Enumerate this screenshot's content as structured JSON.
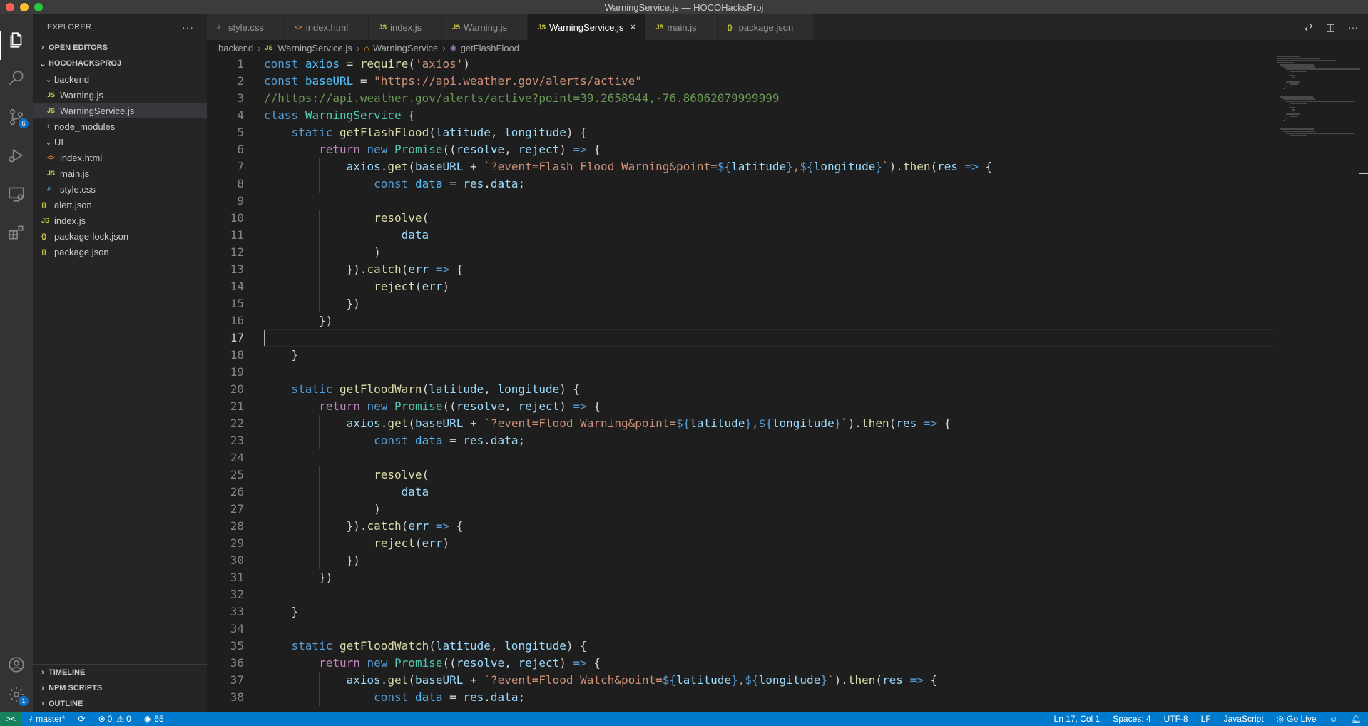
{
  "window": {
    "title": "WarningService.js — HOCOHacksProj"
  },
  "colors": {
    "accent": "#007acc",
    "remote": "#16825d",
    "badge": "#0e70c0"
  },
  "activity_bar": {
    "items": [
      {
        "name": "explorer",
        "icon": "files-icon"
      },
      {
        "name": "search",
        "icon": "search-icon"
      },
      {
        "name": "source-control",
        "icon": "source-control-icon",
        "badge": "6"
      },
      {
        "name": "run-debug",
        "icon": "run-debug-icon"
      },
      {
        "name": "remote-explorer",
        "icon": "remote-explorer-icon"
      },
      {
        "name": "extensions",
        "icon": "extensions-icon"
      }
    ],
    "bottom": [
      {
        "name": "accounts",
        "icon": "account-icon"
      },
      {
        "name": "manage",
        "icon": "gear-icon",
        "badge": "1"
      }
    ]
  },
  "sidebar": {
    "title": "EXPLORER",
    "more": "···",
    "open_editors": "OPEN EDITORS",
    "project": "HOCOHACKSPROJ",
    "tree": [
      {
        "label": "backend",
        "type": "folder",
        "open": true,
        "indent": 1
      },
      {
        "label": "Warning.js",
        "type": "js",
        "indent": 2,
        "icon_text": "JS"
      },
      {
        "label": "WarningService.js",
        "type": "js",
        "indent": 2,
        "icon_text": "JS",
        "selected": true
      },
      {
        "label": "node_modules",
        "type": "folder",
        "open": false,
        "indent": 1
      },
      {
        "label": "UI",
        "type": "folder",
        "open": true,
        "indent": 1
      },
      {
        "label": "index.html",
        "type": "html",
        "indent": 2,
        "icon_text": "<>"
      },
      {
        "label": "main.js",
        "type": "js",
        "indent": 2,
        "icon_text": "JS"
      },
      {
        "label": "style.css",
        "type": "css",
        "indent": 2,
        "icon_text": "#"
      },
      {
        "label": "alert.json",
        "type": "json",
        "indent": 1,
        "icon_text": "{}"
      },
      {
        "label": "index.js",
        "type": "js",
        "indent": 1,
        "icon_text": "JS"
      },
      {
        "label": "package-lock.json",
        "type": "json",
        "indent": 1,
        "icon_text": "{}"
      },
      {
        "label": "package.json",
        "type": "json",
        "indent": 1,
        "icon_text": "{}"
      }
    ],
    "bottom_sections": [
      "TIMELINE",
      "NPM SCRIPTS",
      "OUTLINE"
    ]
  },
  "tabs": [
    {
      "label": "style.css",
      "type": "css",
      "icon_text": "#"
    },
    {
      "label": "index.html",
      "type": "html",
      "icon_text": "<>"
    },
    {
      "label": "index.js",
      "type": "js",
      "icon_text": "JS"
    },
    {
      "label": "Warning.js",
      "type": "js",
      "icon_text": "JS"
    },
    {
      "label": "WarningService.js",
      "type": "js",
      "icon_text": "JS",
      "active": true,
      "close": "✕"
    },
    {
      "label": "main.js",
      "type": "js",
      "icon_text": "JS"
    },
    {
      "label": "package.json",
      "type": "json",
      "icon_text": "{}"
    }
  ],
  "breadcrumb": {
    "folder": "backend",
    "file": "WarningService.js",
    "file_icon": "JS",
    "class": "WarningService",
    "method": "getFlashFlood"
  },
  "editor": {
    "current_line": 17,
    "lines": [
      [
        [
          "k",
          "const"
        ],
        [
          "p",
          " "
        ],
        [
          "cv",
          "axios"
        ],
        [
          "p",
          " = "
        ],
        [
          "f",
          "require"
        ],
        [
          "p",
          "("
        ],
        [
          "s",
          "'axios'"
        ],
        [
          "p",
          ")"
        ]
      ],
      [
        [
          "k",
          "const"
        ],
        [
          "p",
          " "
        ],
        [
          "cv",
          "baseURL"
        ],
        [
          "p",
          " = "
        ],
        [
          "s",
          "\""
        ],
        [
          "u",
          "https://api.weather.gov/alerts/active"
        ],
        [
          "s",
          "\""
        ]
      ],
      [
        [
          "cm",
          "//"
        ],
        [
          "cmu",
          "https://api.weather.gov/alerts/active?point=39.2658944,-76.86062079999999"
        ]
      ],
      [
        [
          "k",
          "class"
        ],
        [
          "p",
          " "
        ],
        [
          "t",
          "WarningService"
        ],
        [
          "p",
          " {"
        ]
      ],
      [
        [
          "p",
          "    "
        ],
        [
          "k",
          "static"
        ],
        [
          "p",
          " "
        ],
        [
          "f",
          "getFlashFlood"
        ],
        [
          "p",
          "("
        ],
        [
          "v",
          "latitude"
        ],
        [
          "p",
          ", "
        ],
        [
          "v",
          "longitude"
        ],
        [
          "p",
          ") {"
        ]
      ],
      [
        [
          "p",
          "        "
        ],
        [
          "c",
          "return"
        ],
        [
          "p",
          " "
        ],
        [
          "k",
          "new"
        ],
        [
          "p",
          " "
        ],
        [
          "t",
          "Promise"
        ],
        [
          "p",
          "(("
        ],
        [
          "v",
          "resolve"
        ],
        [
          "p",
          ", "
        ],
        [
          "v",
          "reject"
        ],
        [
          "p",
          ") "
        ],
        [
          "k",
          "=>"
        ],
        [
          "p",
          " {"
        ]
      ],
      [
        [
          "p",
          "            "
        ],
        [
          "v",
          "axios"
        ],
        [
          "p",
          "."
        ],
        [
          "f",
          "get"
        ],
        [
          "p",
          "("
        ],
        [
          "v",
          "baseURL"
        ],
        [
          "p",
          " + "
        ],
        [
          "s",
          "`?event=Flash Flood Warning&point="
        ],
        [
          "k",
          "${"
        ],
        [
          "v",
          "latitude"
        ],
        [
          "k",
          "}"
        ],
        [
          "s",
          ","
        ],
        [
          "k",
          "${"
        ],
        [
          "v",
          "longitude"
        ],
        [
          "k",
          "}"
        ],
        [
          "s",
          "`"
        ],
        [
          "p",
          ")."
        ],
        [
          "f",
          "then"
        ],
        [
          "p",
          "("
        ],
        [
          "v",
          "res"
        ],
        [
          "p",
          " "
        ],
        [
          "k",
          "=>"
        ],
        [
          "p",
          " {"
        ]
      ],
      [
        [
          "p",
          "                "
        ],
        [
          "k",
          "const"
        ],
        [
          "p",
          " "
        ],
        [
          "cv",
          "data"
        ],
        [
          "p",
          " = "
        ],
        [
          "v",
          "res"
        ],
        [
          "p",
          "."
        ],
        [
          "v",
          "data"
        ],
        [
          "p",
          ";"
        ]
      ],
      [
        [
          "p",
          ""
        ]
      ],
      [
        [
          "p",
          "                "
        ],
        [
          "f",
          "resolve"
        ],
        [
          "p",
          "("
        ]
      ],
      [
        [
          "p",
          "                    "
        ],
        [
          "v",
          "data"
        ]
      ],
      [
        [
          "p",
          "                )"
        ]
      ],
      [
        [
          "p",
          "            })."
        ],
        [
          "f",
          "catch"
        ],
        [
          "p",
          "("
        ],
        [
          "v",
          "err"
        ],
        [
          "p",
          " "
        ],
        [
          "k",
          "=>"
        ],
        [
          "p",
          " {"
        ]
      ],
      [
        [
          "p",
          "                "
        ],
        [
          "f",
          "reject"
        ],
        [
          "p",
          "("
        ],
        [
          "v",
          "err"
        ],
        [
          "p",
          ")"
        ]
      ],
      [
        [
          "p",
          "            })"
        ]
      ],
      [
        [
          "p",
          "        })"
        ]
      ],
      [
        [
          "p",
          ""
        ]
      ],
      [
        [
          "p",
          "    }"
        ]
      ],
      [
        [
          "p",
          ""
        ]
      ],
      [
        [
          "p",
          "    "
        ],
        [
          "k",
          "static"
        ],
        [
          "p",
          " "
        ],
        [
          "f",
          "getFloodWarn"
        ],
        [
          "p",
          "("
        ],
        [
          "v",
          "latitude"
        ],
        [
          "p",
          ", "
        ],
        [
          "v",
          "longitude"
        ],
        [
          "p",
          ") {"
        ]
      ],
      [
        [
          "p",
          "        "
        ],
        [
          "c",
          "return"
        ],
        [
          "p",
          " "
        ],
        [
          "k",
          "new"
        ],
        [
          "p",
          " "
        ],
        [
          "t",
          "Promise"
        ],
        [
          "p",
          "(("
        ],
        [
          "v",
          "resolve"
        ],
        [
          "p",
          ", "
        ],
        [
          "v",
          "reject"
        ],
        [
          "p",
          ") "
        ],
        [
          "k",
          "=>"
        ],
        [
          "p",
          " {"
        ]
      ],
      [
        [
          "p",
          "            "
        ],
        [
          "v",
          "axios"
        ],
        [
          "p",
          "."
        ],
        [
          "f",
          "get"
        ],
        [
          "p",
          "("
        ],
        [
          "v",
          "baseURL"
        ],
        [
          "p",
          " + "
        ],
        [
          "s",
          "`?event=Flood Warning&point="
        ],
        [
          "k",
          "${"
        ],
        [
          "v",
          "latitude"
        ],
        [
          "k",
          "}"
        ],
        [
          "s",
          ","
        ],
        [
          "k",
          "${"
        ],
        [
          "v",
          "longitude"
        ],
        [
          "k",
          "}"
        ],
        [
          "s",
          "`"
        ],
        [
          "p",
          ")."
        ],
        [
          "f",
          "then"
        ],
        [
          "p",
          "("
        ],
        [
          "v",
          "res"
        ],
        [
          "p",
          " "
        ],
        [
          "k",
          "=>"
        ],
        [
          "p",
          " {"
        ]
      ],
      [
        [
          "p",
          "                "
        ],
        [
          "k",
          "const"
        ],
        [
          "p",
          " "
        ],
        [
          "cv",
          "data"
        ],
        [
          "p",
          " = "
        ],
        [
          "v",
          "res"
        ],
        [
          "p",
          "."
        ],
        [
          "v",
          "data"
        ],
        [
          "p",
          ";"
        ]
      ],
      [
        [
          "p",
          ""
        ]
      ],
      [
        [
          "p",
          "                "
        ],
        [
          "f",
          "resolve"
        ],
        [
          "p",
          "("
        ]
      ],
      [
        [
          "p",
          "                    "
        ],
        [
          "v",
          "data"
        ]
      ],
      [
        [
          "p",
          "                )"
        ]
      ],
      [
        [
          "p",
          "            })."
        ],
        [
          "f",
          "catch"
        ],
        [
          "p",
          "("
        ],
        [
          "v",
          "err"
        ],
        [
          "p",
          " "
        ],
        [
          "k",
          "=>"
        ],
        [
          "p",
          " {"
        ]
      ],
      [
        [
          "p",
          "                "
        ],
        [
          "f",
          "reject"
        ],
        [
          "p",
          "("
        ],
        [
          "v",
          "err"
        ],
        [
          "p",
          ")"
        ]
      ],
      [
        [
          "p",
          "            })"
        ]
      ],
      [
        [
          "p",
          "        })"
        ]
      ],
      [
        [
          "p",
          ""
        ]
      ],
      [
        [
          "p",
          "    }"
        ]
      ],
      [
        [
          "p",
          ""
        ]
      ],
      [
        [
          "p",
          "    "
        ],
        [
          "k",
          "static"
        ],
        [
          "p",
          " "
        ],
        [
          "f",
          "getFloodWatch"
        ],
        [
          "p",
          "("
        ],
        [
          "v",
          "latitude"
        ],
        [
          "p",
          ", "
        ],
        [
          "v",
          "longitude"
        ],
        [
          "p",
          ") {"
        ]
      ],
      [
        [
          "p",
          "        "
        ],
        [
          "c",
          "return"
        ],
        [
          "p",
          " "
        ],
        [
          "k",
          "new"
        ],
        [
          "p",
          " "
        ],
        [
          "t",
          "Promise"
        ],
        [
          "p",
          "(("
        ],
        [
          "v",
          "resolve"
        ],
        [
          "p",
          ", "
        ],
        [
          "v",
          "reject"
        ],
        [
          "p",
          ") "
        ],
        [
          "k",
          "=>"
        ],
        [
          "p",
          " {"
        ]
      ],
      [
        [
          "p",
          "            "
        ],
        [
          "v",
          "axios"
        ],
        [
          "p",
          "."
        ],
        [
          "f",
          "get"
        ],
        [
          "p",
          "("
        ],
        [
          "v",
          "baseURL"
        ],
        [
          "p",
          " + "
        ],
        [
          "s",
          "`?event=Flood Watch&point="
        ],
        [
          "k",
          "${"
        ],
        [
          "v",
          "latitude"
        ],
        [
          "k",
          "}"
        ],
        [
          "s",
          ","
        ],
        [
          "k",
          "${"
        ],
        [
          "v",
          "longitude"
        ],
        [
          "k",
          "}"
        ],
        [
          "s",
          "`"
        ],
        [
          "p",
          ")."
        ],
        [
          "f",
          "then"
        ],
        [
          "p",
          "("
        ],
        [
          "v",
          "res"
        ],
        [
          "p",
          " "
        ],
        [
          "k",
          "=>"
        ],
        [
          "p",
          " {"
        ]
      ],
      [
        [
          "p",
          "                "
        ],
        [
          "k",
          "const"
        ],
        [
          "p",
          " "
        ],
        [
          "cv",
          "data"
        ],
        [
          "p",
          " = "
        ],
        [
          "v",
          "res"
        ],
        [
          "p",
          "."
        ],
        [
          "v",
          "data"
        ],
        [
          "p",
          ";"
        ]
      ]
    ]
  },
  "statusbar": {
    "remote_icon": "><",
    "branch": "master*",
    "sync_icon": "⟳",
    "errors": "0",
    "warnings": "0",
    "ports": "65",
    "position": "Ln 17, Col 1",
    "spaces": "Spaces: 4",
    "encoding": "UTF-8",
    "eol": "LF",
    "language": "JavaScript",
    "golive": "Go Live"
  }
}
